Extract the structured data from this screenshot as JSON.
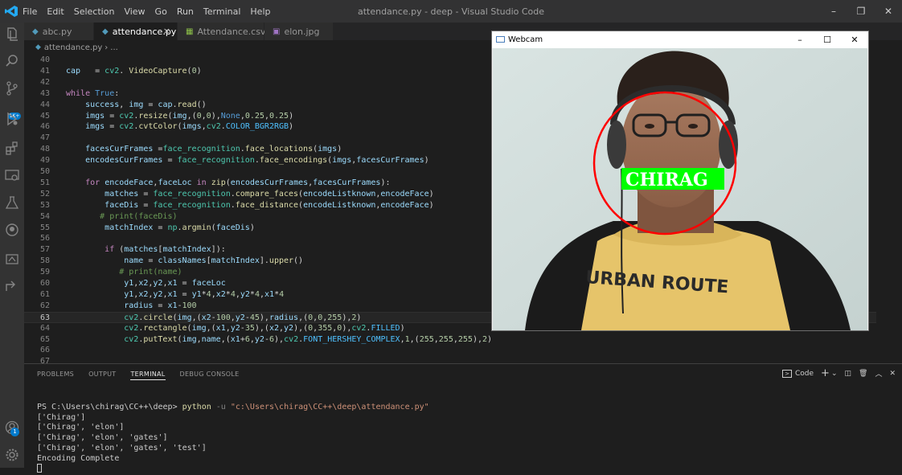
{
  "app": {
    "title": "attendance.py - deep - Visual Studio Code",
    "menu": [
      "File",
      "Edit",
      "Selection",
      "View",
      "Go",
      "Run",
      "Terminal",
      "Help"
    ],
    "window_controls": [
      "–",
      "❐",
      "✕"
    ]
  },
  "activity_bar": {
    "icons": [
      "explorer-icon",
      "search-icon",
      "source-control-icon",
      "run-debug-icon",
      "extensions-icon",
      "remote-explorer-icon",
      "testing-icon",
      "github-icon",
      "docker-icon",
      "live-share-icon",
      "account-icon",
      "settings-gear-icon"
    ],
    "badge": "1K+",
    "settings_badge": "1"
  },
  "tabs": [
    {
      "label": "abc.py",
      "icon": "python-file-icon",
      "active": false
    },
    {
      "label": "attendance.py",
      "icon": "python-file-icon",
      "active": true,
      "close": "×"
    },
    {
      "label": "Attendance.csv",
      "icon": "csv-file-icon",
      "active": false
    },
    {
      "label": "elon.jpg",
      "icon": "image-file-icon",
      "active": false
    }
  ],
  "breadcrumb": {
    "file": "attendance.py",
    "rest": "..."
  },
  "editor": {
    "current_line": 63,
    "lines": [
      {
        "n": "40",
        "tokens": []
      },
      {
        "n": "41",
        "tokens": [
          [
            "v",
            "cap"
          ],
          [
            "",
            "   = "
          ],
          [
            "cl",
            "cv2"
          ],
          [
            "",
            ". "
          ],
          [
            "f",
            "VideoCapture"
          ],
          [
            "",
            "("
          ],
          [
            "n",
            "0"
          ],
          [
            "",
            ")"
          ]
        ]
      },
      {
        "n": "42",
        "tokens": []
      },
      {
        "n": "43",
        "tokens": [
          [
            "kw",
            "while"
          ],
          [
            "",
            " "
          ],
          [
            "k",
            "True"
          ],
          [
            "",
            ":"
          ]
        ]
      },
      {
        "n": "44",
        "tokens": [
          [
            "",
            "    "
          ],
          [
            "v",
            "success"
          ],
          [
            "",
            ", "
          ],
          [
            "v",
            "img"
          ],
          [
            "",
            " = "
          ],
          [
            "v",
            "cap"
          ],
          [
            "",
            "."
          ],
          [
            "f",
            "read"
          ],
          [
            "",
            "()"
          ]
        ]
      },
      {
        "n": "45",
        "tokens": [
          [
            "",
            "    "
          ],
          [
            "v",
            "imgs"
          ],
          [
            "",
            " = "
          ],
          [
            "cl",
            "cv2"
          ],
          [
            "",
            "."
          ],
          [
            "f",
            "resize"
          ],
          [
            "",
            "("
          ],
          [
            "v",
            "img"
          ],
          [
            "",
            ",("
          ],
          [
            "n",
            "0"
          ],
          [
            "",
            ","
          ],
          [
            "n",
            "0"
          ],
          [
            "",
            "),"
          ],
          [
            "k",
            "None"
          ],
          [
            "",
            ","
          ],
          [
            "n",
            "0.25"
          ],
          [
            "",
            ","
          ],
          [
            "n",
            "0.25"
          ],
          [
            "",
            ")"
          ]
        ]
      },
      {
        "n": "46",
        "tokens": [
          [
            "",
            "    "
          ],
          [
            "v",
            "imgs"
          ],
          [
            "",
            " = "
          ],
          [
            "cl",
            "cv2"
          ],
          [
            "",
            "."
          ],
          [
            "f",
            "cvtColor"
          ],
          [
            "",
            "("
          ],
          [
            "v",
            "imgs"
          ],
          [
            "",
            ","
          ],
          [
            "cl",
            "cv2"
          ],
          [
            "",
            "."
          ],
          [
            "con",
            "COLOR_BGR2RGB"
          ],
          [
            "",
            ")"
          ]
        ]
      },
      {
        "n": "47",
        "tokens": []
      },
      {
        "n": "48",
        "tokens": [
          [
            "",
            "    "
          ],
          [
            "v",
            "facesCurFrames"
          ],
          [
            "",
            " ="
          ],
          [
            "cl",
            "face_recognition"
          ],
          [
            "",
            "."
          ],
          [
            "f",
            "face_locations"
          ],
          [
            "",
            "("
          ],
          [
            "v",
            "imgs"
          ],
          [
            "",
            ")"
          ]
        ]
      },
      {
        "n": "49",
        "tokens": [
          [
            "",
            "    "
          ],
          [
            "v",
            "encodesCurFrames"
          ],
          [
            "",
            " = "
          ],
          [
            "cl",
            "face_recognition"
          ],
          [
            "",
            "."
          ],
          [
            "f",
            "face_encodings"
          ],
          [
            "",
            "("
          ],
          [
            "v",
            "imgs"
          ],
          [
            "",
            ","
          ],
          [
            "v",
            "facesCurFrames"
          ],
          [
            "",
            ")"
          ]
        ]
      },
      {
        "n": "50",
        "tokens": []
      },
      {
        "n": "51",
        "tokens": [
          [
            "",
            "    "
          ],
          [
            "kw",
            "for"
          ],
          [
            "",
            " "
          ],
          [
            "v",
            "encodeFace"
          ],
          [
            "",
            ","
          ],
          [
            "v",
            "faceLoc"
          ],
          [
            "",
            " "
          ],
          [
            "kw",
            "in"
          ],
          [
            "",
            " "
          ],
          [
            "f",
            "zip"
          ],
          [
            "",
            "("
          ],
          [
            "v",
            "encodesCurFrames"
          ],
          [
            "",
            ","
          ],
          [
            "v",
            "facesCurFrames"
          ],
          [
            "",
            "):"
          ]
        ]
      },
      {
        "n": "52",
        "tokens": [
          [
            "",
            "        "
          ],
          [
            "v",
            "matches"
          ],
          [
            "",
            " = "
          ],
          [
            "cl",
            "face_recognition"
          ],
          [
            "",
            "."
          ],
          [
            "f",
            "compare_faces"
          ],
          [
            "",
            "("
          ],
          [
            "v",
            "encodeListknown"
          ],
          [
            "",
            ","
          ],
          [
            "v",
            "encodeFace"
          ],
          [
            "",
            ")"
          ]
        ]
      },
      {
        "n": "53",
        "tokens": [
          [
            "",
            "        "
          ],
          [
            "v",
            "faceDis"
          ],
          [
            "",
            " = "
          ],
          [
            "cl",
            "face_recognition"
          ],
          [
            "",
            "."
          ],
          [
            "f",
            "face_distance"
          ],
          [
            "",
            "("
          ],
          [
            "v",
            "encodeListknown"
          ],
          [
            "",
            ","
          ],
          [
            "v",
            "encodeFace"
          ],
          [
            "",
            ")"
          ]
        ]
      },
      {
        "n": "54",
        "tokens": [
          [
            "",
            "       "
          ],
          [
            "c",
            "# print(faceDis)"
          ]
        ]
      },
      {
        "n": "55",
        "tokens": [
          [
            "",
            "        "
          ],
          [
            "v",
            "matchIndex"
          ],
          [
            "",
            " = "
          ],
          [
            "cl",
            "np"
          ],
          [
            "",
            "."
          ],
          [
            "f",
            "argmin"
          ],
          [
            "",
            "("
          ],
          [
            "v",
            "faceDis"
          ],
          [
            "",
            ")"
          ]
        ]
      },
      {
        "n": "56",
        "tokens": []
      },
      {
        "n": "57",
        "tokens": [
          [
            "",
            "        "
          ],
          [
            "kw",
            "if"
          ],
          [
            "",
            " ("
          ],
          [
            "v",
            "matches"
          ],
          [
            "",
            "["
          ],
          [
            "v",
            "matchIndex"
          ],
          [
            "",
            "]):"
          ]
        ]
      },
      {
        "n": "58",
        "tokens": [
          [
            "",
            "            "
          ],
          [
            "v",
            "name"
          ],
          [
            "",
            " = "
          ],
          [
            "v",
            "classNames"
          ],
          [
            "",
            "["
          ],
          [
            "v",
            "matchIndex"
          ],
          [
            "",
            "]."
          ],
          [
            "f",
            "upper"
          ],
          [
            "",
            "()"
          ]
        ]
      },
      {
        "n": "59",
        "tokens": [
          [
            "",
            "           "
          ],
          [
            "c",
            "# print(name)"
          ]
        ]
      },
      {
        "n": "60",
        "tokens": [
          [
            "",
            "            "
          ],
          [
            "v",
            "y1"
          ],
          [
            "",
            ","
          ],
          [
            "v",
            "x2"
          ],
          [
            "",
            ","
          ],
          [
            "v",
            "y2"
          ],
          [
            "",
            ","
          ],
          [
            "v",
            "x1"
          ],
          [
            "",
            " = "
          ],
          [
            "v",
            "faceLoc"
          ]
        ]
      },
      {
        "n": "61",
        "tokens": [
          [
            "",
            "            "
          ],
          [
            "v",
            "y1"
          ],
          [
            "",
            ","
          ],
          [
            "v",
            "x2"
          ],
          [
            "",
            ","
          ],
          [
            "v",
            "y2"
          ],
          [
            "",
            ","
          ],
          [
            "v",
            "x1"
          ],
          [
            "",
            " = "
          ],
          [
            "v",
            "y1"
          ],
          [
            "",
            "*"
          ],
          [
            "n",
            "4"
          ],
          [
            "",
            ","
          ],
          [
            "v",
            "x2"
          ],
          [
            "",
            "*"
          ],
          [
            "n",
            "4"
          ],
          [
            "",
            ","
          ],
          [
            "v",
            "y2"
          ],
          [
            "",
            "*"
          ],
          [
            "n",
            "4"
          ],
          [
            "",
            ","
          ],
          [
            "v",
            "x1"
          ],
          [
            "",
            "*"
          ],
          [
            "n",
            "4"
          ]
        ]
      },
      {
        "n": "62",
        "tokens": [
          [
            "",
            "            "
          ],
          [
            "v",
            "radius"
          ],
          [
            "",
            " = "
          ],
          [
            "v",
            "x1"
          ],
          [
            "",
            "-"
          ],
          [
            "n",
            "100"
          ]
        ]
      },
      {
        "n": "63",
        "tokens": [
          [
            "",
            "            "
          ],
          [
            "cl",
            "cv2"
          ],
          [
            "",
            "."
          ],
          [
            "f",
            "circle"
          ],
          [
            "",
            "("
          ],
          [
            "v",
            "img"
          ],
          [
            "",
            ",("
          ],
          [
            "v",
            "x2"
          ],
          [
            "",
            "-"
          ],
          [
            "n",
            "100"
          ],
          [
            "",
            ","
          ],
          [
            "v",
            "y2"
          ],
          [
            "",
            "-"
          ],
          [
            "n",
            "45"
          ],
          [
            "",
            "),"
          ],
          [
            "v",
            "radius"
          ],
          [
            "",
            ",("
          ],
          [
            "n",
            "0"
          ],
          [
            "",
            ","
          ],
          [
            "n",
            "0"
          ],
          [
            "",
            ","
          ],
          [
            "n",
            "255"
          ],
          [
            "",
            "),"
          ],
          [
            "n",
            "2"
          ],
          [
            "",
            ")"
          ]
        ]
      },
      {
        "n": "64",
        "tokens": [
          [
            "",
            "            "
          ],
          [
            "cl",
            "cv2"
          ],
          [
            "",
            "."
          ],
          [
            "f",
            "rectangle"
          ],
          [
            "",
            "("
          ],
          [
            "v",
            "img"
          ],
          [
            "",
            ",("
          ],
          [
            "v",
            "x1"
          ],
          [
            "",
            ","
          ],
          [
            "v",
            "y2"
          ],
          [
            "",
            "-"
          ],
          [
            "n",
            "35"
          ],
          [
            "",
            "),("
          ],
          [
            "v",
            "x2"
          ],
          [
            "",
            ","
          ],
          [
            "v",
            "y2"
          ],
          [
            "",
            "),("
          ],
          [
            "n",
            "0"
          ],
          [
            "",
            ","
          ],
          [
            "n",
            "355"
          ],
          [
            "",
            ","
          ],
          [
            "n",
            "0"
          ],
          [
            "",
            "),"
          ],
          [
            "cl",
            "cv2"
          ],
          [
            "",
            "."
          ],
          [
            "con",
            "FILLED"
          ],
          [
            "",
            ")"
          ]
        ]
      },
      {
        "n": "65",
        "tokens": [
          [
            "",
            "            "
          ],
          [
            "cl",
            "cv2"
          ],
          [
            "",
            "."
          ],
          [
            "f",
            "putText"
          ],
          [
            "",
            "("
          ],
          [
            "v",
            "img"
          ],
          [
            "",
            ","
          ],
          [
            "v",
            "name"
          ],
          [
            "",
            ",("
          ],
          [
            "v",
            "x1"
          ],
          [
            "",
            "+"
          ],
          [
            "n",
            "6"
          ],
          [
            "",
            ","
          ],
          [
            "v",
            "y2"
          ],
          [
            "",
            "-"
          ],
          [
            "n",
            "6"
          ],
          [
            "",
            "),"
          ],
          [
            "cl",
            "cv2"
          ],
          [
            "",
            "."
          ],
          [
            "con",
            "FONT_HERSHEY_COMPLEX"
          ],
          [
            "",
            ","
          ],
          [
            "n",
            "1"
          ],
          [
            "",
            ",("
          ],
          [
            "n",
            "255"
          ],
          [
            "",
            ","
          ],
          [
            "n",
            "255"
          ],
          [
            "",
            ","
          ],
          [
            "n",
            "255"
          ],
          [
            "",
            "),"
          ],
          [
            "n",
            "2"
          ],
          [
            "",
            ")"
          ]
        ]
      },
      {
        "n": "66",
        "tokens": []
      },
      {
        "n": "67",
        "tokens": []
      }
    ]
  },
  "panel": {
    "tabs": [
      "PROBLEMS",
      "OUTPUT",
      "TERMINAL",
      "DEBUG CONSOLE"
    ],
    "active_tab": "TERMINAL",
    "terminal_name": "Code",
    "terminal": {
      "prompt": "PS C:\\Users\\chirag\\CC++\\deep> ",
      "command": "python",
      "flag": " -u ",
      "arg": "\"c:\\Users\\chirag\\CC++\\deep\\attendance.py\"",
      "output": [
        "['Chirag']",
        "['Chirag', 'elon']",
        "['Chirag', 'elon', 'gates']",
        "['Chirag', 'elon', 'gates', 'test']",
        "Encoding Complete"
      ]
    }
  },
  "webcam": {
    "title": "Webcam",
    "controls": [
      "–",
      "☐",
      "✕"
    ],
    "detected_name": "CHIRAG",
    "shirt_text": "URBAN ROUTE"
  },
  "colors": {
    "accent": "#007acc",
    "circle": "#ff0000",
    "label_box": "#00ff00"
  }
}
